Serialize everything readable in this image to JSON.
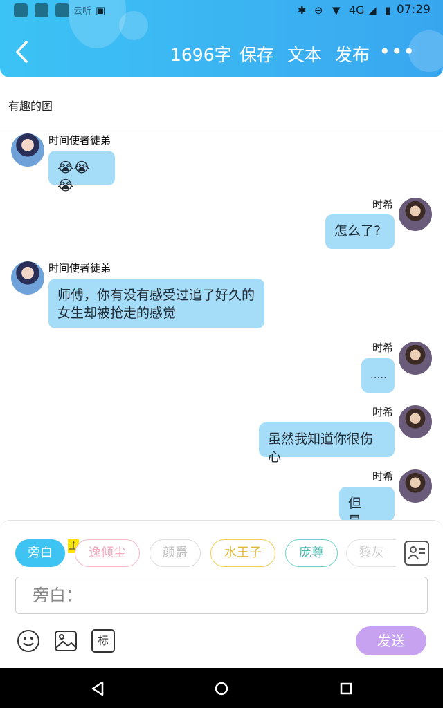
{
  "statusbar": {
    "time": "07:29",
    "network": "4G",
    "app_label": "云听"
  },
  "header": {
    "word_count": "1696字",
    "save": "保存",
    "text": "文本",
    "publish": "发布",
    "more": "•••"
  },
  "doc_title": "有趣的图",
  "messages": [
    {
      "side": "left",
      "name": "时间使者徒弟",
      "text": "😭😭😭"
    },
    {
      "side": "right",
      "name": "时希",
      "text": "怎么了?"
    },
    {
      "side": "left",
      "name": "时间使者徒弟",
      "text": "师傅，你有没有感受过追了好久的女生却被抢走的感觉"
    },
    {
      "side": "right",
      "name": "时希",
      "text": "....."
    },
    {
      "side": "right",
      "name": "时希",
      "text": "虽然我知道你很伤心"
    },
    {
      "side": "right",
      "name": "时希",
      "text": "但是..."
    }
  ],
  "composer": {
    "chips": [
      {
        "label": "旁白",
        "color": "#3ec4f3"
      },
      {
        "label": "逸倾尘",
        "color": "#f6b7c7"
      },
      {
        "label": "颜爵",
        "color": "#d4d4d4"
      },
      {
        "label": "水王子",
        "color": "#f2cf55"
      },
      {
        "label": "庞尊",
        "color": "#6bd0c8"
      },
      {
        "label": "黎灰",
        "color": "#d4d4d4"
      }
    ],
    "badge": "主",
    "input_placeholder": "旁白：",
    "send": "发送",
    "tag_button": "标"
  }
}
